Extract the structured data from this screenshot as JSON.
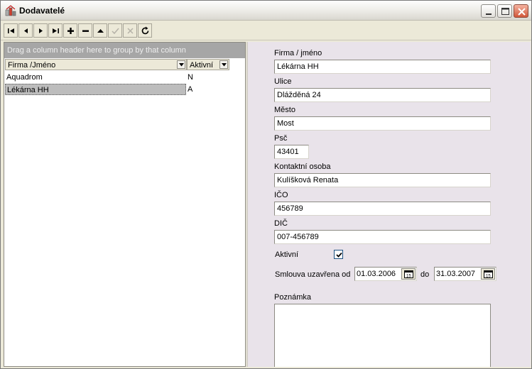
{
  "window": {
    "title": "Dodavatelé",
    "controls": [
      "minimize-icon",
      "maximize-icon",
      "close-icon"
    ]
  },
  "toolbar": {
    "buttons": [
      {
        "name": "first-record",
        "icon": "first-icon",
        "enabled": true
      },
      {
        "name": "prior-record",
        "icon": "prior-icon",
        "enabled": true
      },
      {
        "name": "next-record",
        "icon": "next-icon",
        "enabled": true
      },
      {
        "name": "last-record",
        "icon": "last-icon",
        "enabled": true
      },
      {
        "name": "insert-record",
        "icon": "plus-icon",
        "enabled": true
      },
      {
        "name": "delete-record",
        "icon": "minus-icon",
        "enabled": true
      },
      {
        "name": "edit-record",
        "icon": "up-triangle-icon",
        "enabled": true
      },
      {
        "name": "post-record",
        "icon": "checkmark-icon",
        "enabled": false
      },
      {
        "name": "cancel-edit",
        "icon": "x-icon",
        "enabled": false
      },
      {
        "name": "refresh",
        "icon": "refresh-icon",
        "enabled": true
      }
    ]
  },
  "grid": {
    "group_panel_text": "Drag a column header here to group by that column",
    "columns": [
      "Firma /Jméno",
      "Aktivní"
    ],
    "rows": [
      {
        "firma": "Aquadrom",
        "aktivni": "N",
        "selected": false
      },
      {
        "firma": "Lékárna HH",
        "aktivni": "A",
        "selected": true
      }
    ]
  },
  "form": {
    "firma_label": "Firma / jméno",
    "firma_value": "Lékárna HH",
    "ulice_label": "Ulice",
    "ulice_value": "Dlážděná 24",
    "mesto_label": "Město",
    "mesto_value": "Most",
    "psc_label": "Psč",
    "psc_value": "43401",
    "kontakt_label": "Kontaktní osoba",
    "kontakt_value": "Kulíšková Renata",
    "ico_label": "IČO",
    "ico_value": "456789",
    "dic_label": "DIČ",
    "dic_value": "007-456789",
    "aktivni_label": "Aktivní",
    "aktivni_checked": true,
    "smlouva_label": "Smlouva uzavřena od",
    "smlouva_od": "01.03.2006",
    "do_label": "do",
    "smlouva_do": "31.03.2007",
    "poznamka_label": "Poznámka",
    "poznamka_value": ""
  },
  "colors": {
    "face": "#ece9d8",
    "form_bg": "#e9e3ea",
    "group_panel": "#a6a6a6",
    "selected_row": "#bdbdbd"
  }
}
